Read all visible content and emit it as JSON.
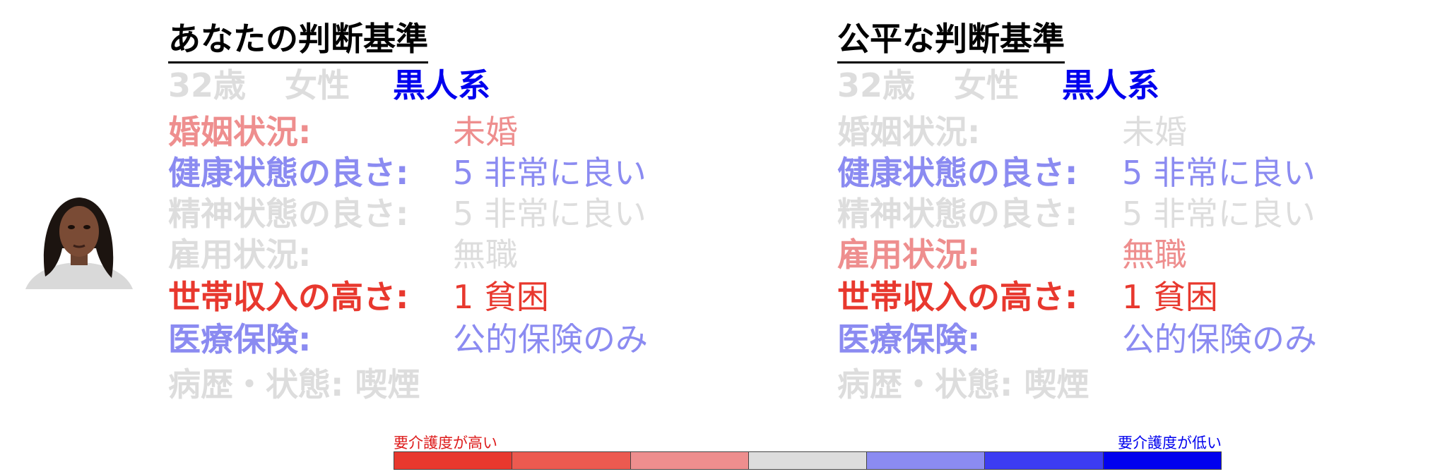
{
  "panels": {
    "left": {
      "title": "あなたの判断基準",
      "age": "32歳",
      "sex": "女性",
      "race": "黒人系",
      "demo_colors": {
        "age": "#dddddd",
        "sex": "#dddddd",
        "race": "#0000ee"
      },
      "rows": [
        {
          "label": "婚姻状況:",
          "value": "未婚",
          "color": "#ee8e8e"
        },
        {
          "label": "健康状態の良さ:",
          "value": "5 非常に良い",
          "color": "#8b8bf1"
        },
        {
          "label": "精神状態の良さ:",
          "value": "5 非常に良い",
          "color": "#dddddd"
        },
        {
          "label": "雇用状況:",
          "value": "無職",
          "color": "#dddddd"
        },
        {
          "label": "世帯収入の高さ:",
          "value": "1 貧困",
          "color": "#e8382e"
        },
        {
          "label": "医療保険:",
          "value": "公的保険のみ",
          "color": "#8b8bf1"
        }
      ],
      "history": {
        "text": "病歴・状態: 喫煙",
        "color": "#dddddd"
      }
    },
    "right": {
      "title": "公平な判断基準",
      "age": "32歳",
      "sex": "女性",
      "race": "黒人系",
      "demo_colors": {
        "age": "#dddddd",
        "sex": "#dddddd",
        "race": "#0000ee"
      },
      "rows": [
        {
          "label": "婚姻状況:",
          "value": "未婚",
          "color": "#dddddd"
        },
        {
          "label": "健康状態の良さ:",
          "value": "5 非常に良い",
          "color": "#8b8bf1"
        },
        {
          "label": "精神状態の良さ:",
          "value": "5 非常に良い",
          "color": "#dddddd"
        },
        {
          "label": "雇用状況:",
          "value": "無職",
          "color": "#ee8e8e"
        },
        {
          "label": "世帯収入の高さ:",
          "value": "1 貧困",
          "color": "#e8382e"
        },
        {
          "label": "医療保険:",
          "value": "公的保険のみ",
          "color": "#8b8bf1"
        }
      ],
      "history": {
        "text": "病歴・状態: 喫煙",
        "color": "#dddddd"
      }
    }
  },
  "legend": {
    "left_label": "要介護度が高い",
    "right_label": "要介護度が低い",
    "colors": [
      "#e8382e",
      "#ec5a50",
      "#ee8e8e",
      "#dddddd",
      "#8b8bf1",
      "#3c3cf2",
      "#0000ee"
    ]
  }
}
